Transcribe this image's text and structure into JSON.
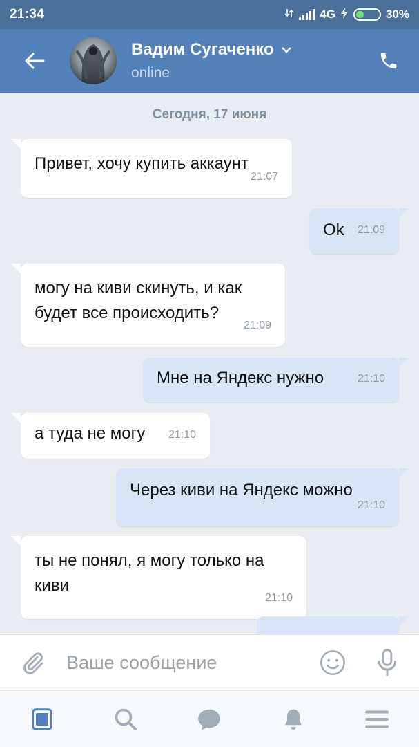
{
  "status_bar": {
    "time": "21:34",
    "network": "4G",
    "battery": "30%",
    "battery_level": 0.3
  },
  "header": {
    "contact_name": "Вадим Сугаченко",
    "status": "online",
    "back_icon": "arrow-left-icon",
    "call_icon": "phone-icon"
  },
  "chat": {
    "date_separator": "Сегодня, 17 июня",
    "messages": [
      {
        "direction": "in",
        "lines": [
          "Привет, хочу купить аккаунт"
        ],
        "time": "21:07"
      },
      {
        "direction": "out",
        "lines": [
          "Ok"
        ],
        "time": "21:09"
      },
      {
        "direction": "in",
        "lines": [
          "могу на киви скинуть, и как",
          "будет все происходить?"
        ],
        "time": "21:09"
      },
      {
        "direction": "out",
        "lines": [
          "Мне на Яндекс нужно"
        ],
        "time": "21:10"
      },
      {
        "direction": "in",
        "lines": [
          "а туда не могу"
        ],
        "time": "21:10"
      },
      {
        "direction": "out",
        "lines": [
          "Через киви на Яндекс можно"
        ],
        "time": "21:10"
      },
      {
        "direction": "in",
        "lines": [
          "ты не понял, я могу только на",
          "киви"
        ],
        "time": "21:10"
      }
    ]
  },
  "input": {
    "placeholder": "Ваше сообщение"
  },
  "colors": {
    "header": "#5181b8",
    "status_bar": "#4a6f99",
    "outgoing_bubble": "#d7e5f7",
    "incoming_bubble": "#ffffff",
    "background": "#e9edf2",
    "nav_active": "#5181b8",
    "nav_inactive": "#a3adb8"
  },
  "bottom_nav": [
    {
      "icon": "news-icon",
      "active": true
    },
    {
      "icon": "search-icon",
      "active": false
    },
    {
      "icon": "messages-icon",
      "active": false
    },
    {
      "icon": "bell-icon",
      "active": false
    },
    {
      "icon": "menu-icon",
      "active": false
    }
  ]
}
